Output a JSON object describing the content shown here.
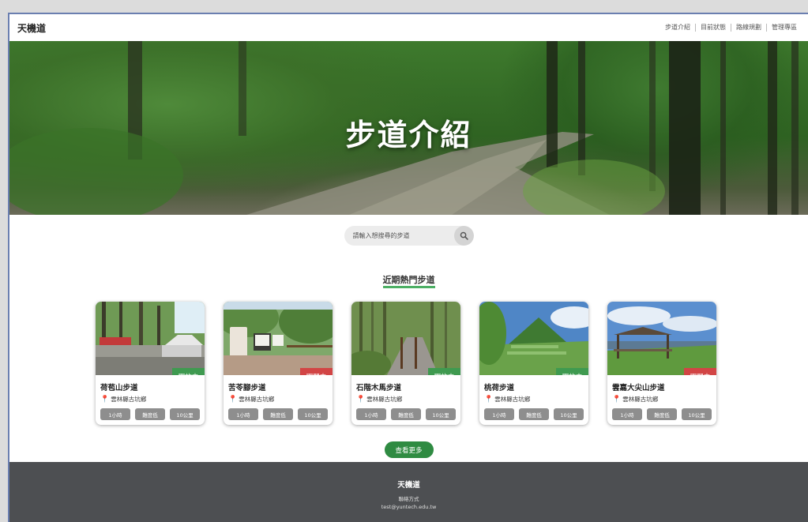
{
  "header": {
    "brand": "天機道",
    "nav": [
      "步道介紹",
      "目前狀態",
      "路線規劃",
      "管理專區"
    ]
  },
  "hero": {
    "title": "步道介紹"
  },
  "search": {
    "placeholder": "請輸入想搜尋的步道",
    "icon": "search-icon"
  },
  "section": {
    "title": "近期熱門步道"
  },
  "colors": {
    "open": "#3f9a50",
    "closed": "#d24545",
    "accent": "#2f8b42",
    "footer": "#4d4f52"
  },
  "trails": [
    {
      "name": "荷苞山步道",
      "location": "雲林縣古坑鄉",
      "status": "開放中",
      "open": true,
      "tags": [
        "1小時",
        "難度低",
        "10公里"
      ]
    },
    {
      "name": "苦苓腳步道",
      "location": "雲林縣古坑鄉",
      "status": "關閉中",
      "open": false,
      "tags": [
        "1小時",
        "難度低",
        "10公里"
      ]
    },
    {
      "name": "石階木馬步道",
      "location": "雲林縣古坑鄉",
      "status": "開放中",
      "open": true,
      "tags": [
        "1小時",
        "難度低",
        "10公里"
      ]
    },
    {
      "name": "桃荷步道",
      "location": "雲林縣古坑鄉",
      "status": "開放中",
      "open": true,
      "tags": [
        "1小時",
        "難度低",
        "10公里"
      ]
    },
    {
      "name": "雲嘉大尖山步道",
      "location": "雲林縣古坑鄉",
      "status": "關閉中",
      "open": false,
      "tags": [
        "1小時",
        "難度低",
        "10公里"
      ]
    }
  ],
  "more_button": "查看更多",
  "footer": {
    "brand": "天機道",
    "contact_label": "聯絡方式",
    "email": "test@yuntech.edu.tw"
  }
}
